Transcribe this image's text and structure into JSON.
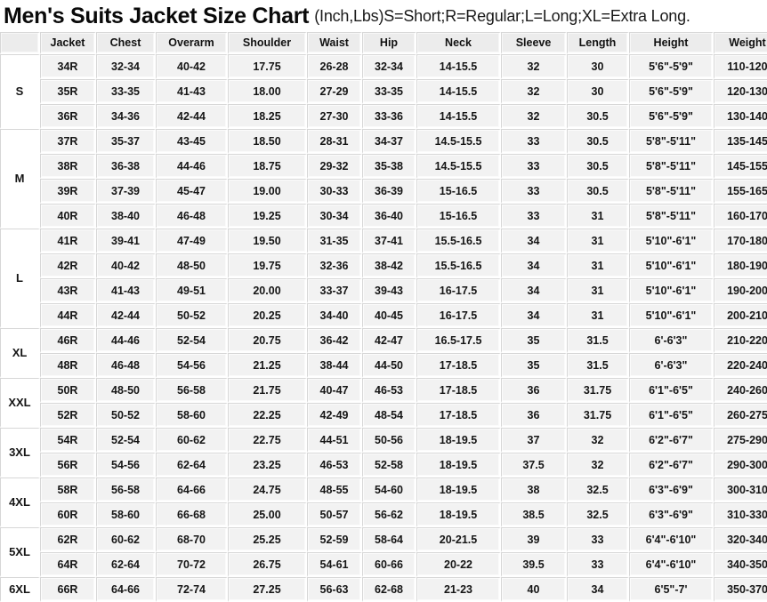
{
  "title": {
    "main": "Men's Suits Jacket Size Chart",
    "sub": "(Inch,Lbs)S=Short;R=Regular;L=Long;XL=Extra Long."
  },
  "table": {
    "corner_label": "",
    "columns": [
      "Jacket",
      "Chest",
      "Overarm",
      "Shoulder",
      "Waist",
      "Hip",
      "Neck",
      "Sleeve",
      "Length",
      "Height",
      "Weight"
    ],
    "groups": [
      {
        "size": "S",
        "rows": [
          [
            "34R",
            "32-34",
            "40-42",
            "17.75",
            "26-28",
            "32-34",
            "14-15.5",
            "32",
            "30",
            "5'6\"-5'9\"",
            "110-120"
          ],
          [
            "35R",
            "33-35",
            "41-43",
            "18.00",
            "27-29",
            "33-35",
            "14-15.5",
            "32",
            "30",
            "5'6\"-5'9\"",
            "120-130"
          ],
          [
            "36R",
            "34-36",
            "42-44",
            "18.25",
            "27-30",
            "33-36",
            "14-15.5",
            "32",
            "30.5",
            "5'6\"-5'9\"",
            "130-140"
          ]
        ]
      },
      {
        "size": "M",
        "rows": [
          [
            "37R",
            "35-37",
            "43-45",
            "18.50",
            "28-31",
            "34-37",
            "14.5-15.5",
            "33",
            "30.5",
            "5'8\"-5'11\"",
            "135-145"
          ],
          [
            "38R",
            "36-38",
            "44-46",
            "18.75",
            "29-32",
            "35-38",
            "14.5-15.5",
            "33",
            "30.5",
            "5'8\"-5'11\"",
            "145-155"
          ],
          [
            "39R",
            "37-39",
            "45-47",
            "19.00",
            "30-33",
            "36-39",
            "15-16.5",
            "33",
            "30.5",
            "5'8\"-5'11\"",
            "155-165"
          ],
          [
            "40R",
            "38-40",
            "46-48",
            "19.25",
            "30-34",
            "36-40",
            "15-16.5",
            "33",
            "31",
            "5'8\"-5'11\"",
            "160-170"
          ]
        ]
      },
      {
        "size": "L",
        "rows": [
          [
            "41R",
            "39-41",
            "47-49",
            "19.50",
            "31-35",
            "37-41",
            "15.5-16.5",
            "34",
            "31",
            "5'10\"-6'1\"",
            "170-180"
          ],
          [
            "42R",
            "40-42",
            "48-50",
            "19.75",
            "32-36",
            "38-42",
            "15.5-16.5",
            "34",
            "31",
            "5'10\"-6'1\"",
            "180-190"
          ],
          [
            "43R",
            "41-43",
            "49-51",
            "20.00",
            "33-37",
            "39-43",
            "16-17.5",
            "34",
            "31",
            "5'10\"-6'1\"",
            "190-200"
          ],
          [
            "44R",
            "42-44",
            "50-52",
            "20.25",
            "34-40",
            "40-45",
            "16-17.5",
            "34",
            "31",
            "5'10\"-6'1\"",
            "200-210"
          ]
        ]
      },
      {
        "size": "XL",
        "rows": [
          [
            "46R",
            "44-46",
            "52-54",
            "20.75",
            "36-42",
            "42-47",
            "16.5-17.5",
            "35",
            "31.5",
            "6'-6'3\"",
            "210-220"
          ],
          [
            "48R",
            "46-48",
            "54-56",
            "21.25",
            "38-44",
            "44-50",
            "17-18.5",
            "35",
            "31.5",
            "6'-6'3\"",
            "220-240"
          ]
        ]
      },
      {
        "size": "XXL",
        "rows": [
          [
            "50R",
            "48-50",
            "56-58",
            "21.75",
            "40-47",
            "46-53",
            "17-18.5",
            "36",
            "31.75",
            "6'1\"-6'5\"",
            "240-260"
          ],
          [
            "52R",
            "50-52",
            "58-60",
            "22.25",
            "42-49",
            "48-54",
            "17-18.5",
            "36",
            "31.75",
            "6'1\"-6'5\"",
            "260-275"
          ]
        ]
      },
      {
        "size": "3XL",
        "rows": [
          [
            "54R",
            "52-54",
            "60-62",
            "22.75",
            "44-51",
            "50-56",
            "18-19.5",
            "37",
            "32",
            "6'2\"-6'7\"",
            "275-290"
          ],
          [
            "56R",
            "54-56",
            "62-64",
            "23.25",
            "46-53",
            "52-58",
            "18-19.5",
            "37.5",
            "32",
            "6'2\"-6'7\"",
            "290-300"
          ]
        ]
      },
      {
        "size": "4XL",
        "rows": [
          [
            "58R",
            "56-58",
            "64-66",
            "24.75",
            "48-55",
            "54-60",
            "18-19.5",
            "38",
            "32.5",
            "6'3\"-6'9\"",
            "300-310"
          ],
          [
            "60R",
            "58-60",
            "66-68",
            "25.00",
            "50-57",
            "56-62",
            "18-19.5",
            "38.5",
            "32.5",
            "6'3\"-6'9\"",
            "310-330"
          ]
        ]
      },
      {
        "size": "5XL",
        "rows": [
          [
            "62R",
            "60-62",
            "68-70",
            "25.25",
            "52-59",
            "58-64",
            "20-21.5",
            "39",
            "33",
            "6'4\"-6'10\"",
            "320-340"
          ],
          [
            "64R",
            "62-64",
            "70-72",
            "26.75",
            "54-61",
            "60-66",
            "20-22",
            "39.5",
            "33",
            "6'4\"-6'10\"",
            "340-350"
          ]
        ]
      },
      {
        "size": "6XL",
        "rows": [
          [
            "66R",
            "64-66",
            "72-74",
            "27.25",
            "56-63",
            "62-68",
            "21-23",
            "40",
            "34",
            "6'5\"-7'",
            "350-370"
          ]
        ]
      }
    ]
  }
}
